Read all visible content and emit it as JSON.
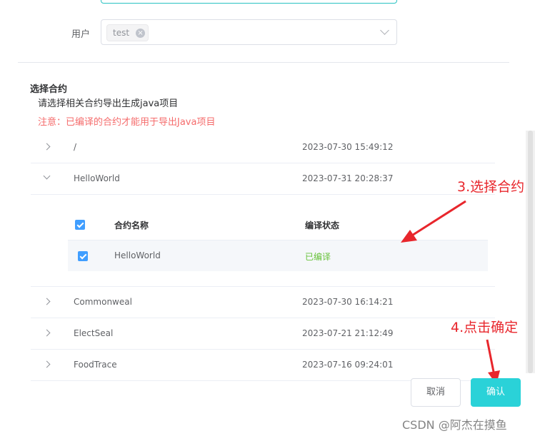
{
  "form": {
    "user_label": "用户",
    "user_tag": "test"
  },
  "section": {
    "title": "选择合约",
    "description": "请选择相关合约导出生成java项目",
    "note": "注意：已编译的合约才能用于导出Java项目"
  },
  "projects": [
    {
      "name": "/",
      "time": "2023-07-30 15:49:12",
      "expanded": false
    },
    {
      "name": "HelloWorld",
      "time": "2023-07-31 20:28:37",
      "expanded": true
    },
    {
      "name": "Commonweal",
      "time": "2023-07-30 16:14:21",
      "expanded": false
    },
    {
      "name": "ElectSeal",
      "time": "2023-07-21 21:12:49",
      "expanded": false
    },
    {
      "name": "FoodTrace",
      "time": "2023-07-16 09:24:01",
      "expanded": false
    }
  ],
  "contracts_table": {
    "headers": [
      "合约名称",
      "编译状态"
    ],
    "rows": [
      {
        "name": "HelloWorld",
        "status": "已编译",
        "checked": true
      }
    ],
    "status_color": "#67c23a"
  },
  "annotations": {
    "step3": "3.选择合约",
    "step4": "4.点击确定",
    "color": "#e8262c"
  },
  "buttons": {
    "cancel": "取消",
    "confirm": "确认"
  },
  "watermark": "CSDN @阿杰在摸鱼",
  "colors": {
    "accent": "#2ad2d8",
    "checkbox": "#409eff",
    "warning": "#f56c6c"
  }
}
